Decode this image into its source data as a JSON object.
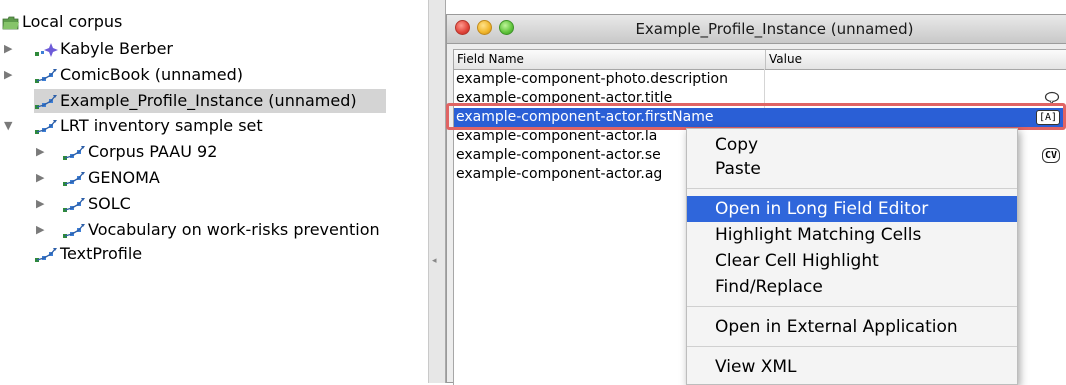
{
  "tree": {
    "root": {
      "label": "Local corpus",
      "icon": "folder-icon"
    },
    "items": [
      {
        "label": "Kabyle Berber",
        "icon": "profile-star-icon"
      },
      {
        "label": "ComicBook (unnamed)",
        "icon": "network-node-icon"
      },
      {
        "label": "Example_Profile_Instance (unnamed)",
        "icon": "network-node-icon"
      },
      {
        "label": "LRT inventory sample set",
        "icon": "network-node-icon"
      },
      {
        "label": "Corpus PAAU 92",
        "icon": "network-node-icon"
      },
      {
        "label": "GENOMA",
        "icon": "network-node-icon"
      },
      {
        "label": "SOLC",
        "icon": "network-node-icon"
      },
      {
        "label": "Vocabulary on work-risks prevention",
        "icon": "network-node-icon"
      },
      {
        "label": "TextProfile",
        "icon": "network-node-icon"
      }
    ]
  },
  "window": {
    "title": "Example_Profile_Instance (unnamed)",
    "columns": {
      "field": "Field Name",
      "value": "Value"
    },
    "rows": [
      {
        "field": "example-component-photo.description"
      },
      {
        "field": "example-component-actor.title",
        "badge": "speech-bubble-icon"
      },
      {
        "field": "example-component-actor.firstName",
        "badge": "[A]"
      },
      {
        "field": "example-component-actor.la"
      },
      {
        "field": "example-component-actor.se",
        "badge": "CV"
      },
      {
        "field": "example-component-actor.ag"
      }
    ]
  },
  "context_menu": {
    "items": [
      {
        "label": "Copy"
      },
      {
        "label": "Paste"
      },
      {
        "label": "Open in Long Field Editor"
      },
      {
        "label": "Highlight Matching Cells"
      },
      {
        "label": "Clear Cell Highlight"
      },
      {
        "label": "Find/Replace"
      },
      {
        "label": "Open in External Application"
      },
      {
        "label": "View XML"
      }
    ]
  },
  "colors": {
    "selection_blue": "#2a5fd6",
    "menu_highlight": "#2f66db",
    "annotation_red": "#e06464",
    "tree_selected": "#d4d4d4"
  }
}
